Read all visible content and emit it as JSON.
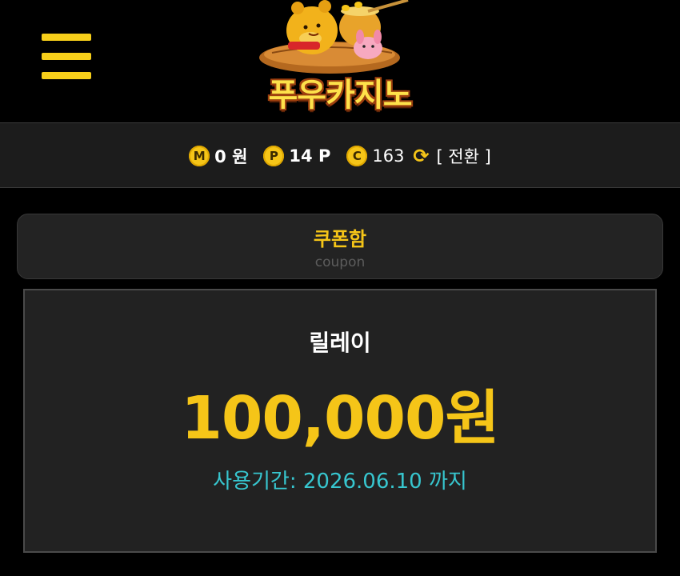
{
  "header": {
    "brand_name": "푸우카지노",
    "menu_icon": "hamburger-menu-icon",
    "logo_icon": "winnie-the-pooh-honey-pot-logo"
  },
  "status": {
    "money_icon_letter": "M",
    "money_value": "0 원",
    "point_icon_letter": "P",
    "point_value": "14 P",
    "coin_icon_letter": "C",
    "coin_value": "163",
    "refresh_icon": "refresh-icon",
    "convert_label": "[ 전환 ]",
    "accent_color": "#f5c518"
  },
  "coupon_section": {
    "title": "쿠폰함",
    "subtitle": "coupon"
  },
  "coupon": {
    "name": "릴레이",
    "amount": "100,000원",
    "expiry": "사용기간: 2026.06.10 까지",
    "amount_color": "#f5c518",
    "expiry_color": "#37c6cf"
  }
}
